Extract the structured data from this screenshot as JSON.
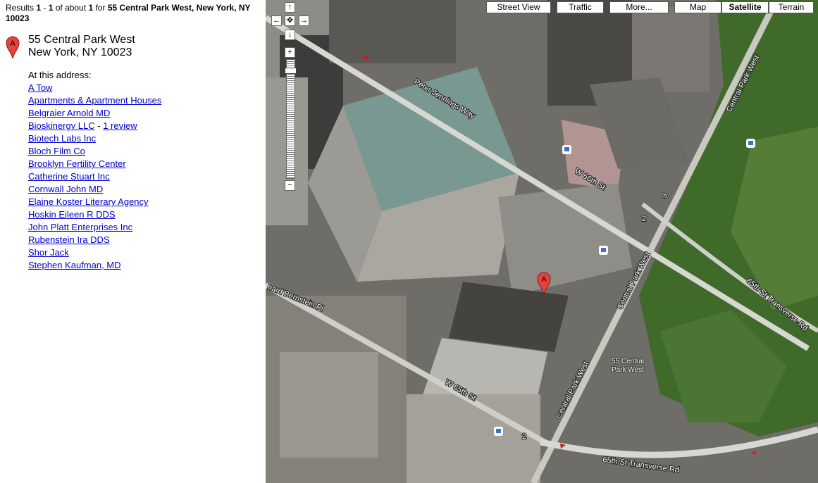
{
  "results": {
    "prefix": "Results ",
    "from": "1",
    "dash": " - ",
    "to": "1",
    "of_text": " of about ",
    "total": "1",
    "for_text": " for ",
    "query": "55 Central Park West, New York, NY 10023"
  },
  "marker_letter": "A",
  "address": {
    "line1": "55 Central Park West",
    "line2": "New York, NY 10023"
  },
  "at_address_label": "At this address:",
  "businesses": [
    {
      "name": "A Tow"
    },
    {
      "name": "Apartments & Apartment Houses"
    },
    {
      "name": "Belgraier Arnold MD"
    },
    {
      "name": "Bioskinergy LLC",
      "sep": " - ",
      "review": "1 review"
    },
    {
      "name": "Biotech Labs Inc"
    },
    {
      "name": "Bloch Film Co"
    },
    {
      "name": "Brooklyn Fertility Center"
    },
    {
      "name": "Catherine Stuart Inc"
    },
    {
      "name": "Cornwall John MD"
    },
    {
      "name": "Elaine Koster Literary Agency"
    },
    {
      "name": "Hoskin Eileen R DDS"
    },
    {
      "name": "John Platt Enterprises Inc"
    },
    {
      "name": "Rubenstein Ira DDS"
    },
    {
      "name": "Shor Jack"
    },
    {
      "name": "Stephen Kaufman, MD"
    }
  ],
  "map_buttons": {
    "street_view": "Street View",
    "traffic": "Traffic",
    "more": "More...",
    "map": "Map",
    "satellite": "Satellite",
    "terrain": "Terrain"
  },
  "nav": {
    "up": "↑",
    "left": "←",
    "center": "✥",
    "right": "→",
    "down": "↓",
    "zoom_in": "+",
    "zoom_out": "−"
  },
  "streets": {
    "peter_jennings": "Peter Jennings Way",
    "w66": "W 66th St",
    "cpw1": "Central Park West",
    "cpw2": "Central Park West",
    "cpw3": "Central Park West",
    "transverse65a": "65th St Transverse Rd",
    "transverse65b": "65th St Transverse Rd",
    "bernstein": "nard Bernstein Pl",
    "w65": "W 65th St",
    "route_a": "2",
    "route_b": "2",
    "route_c": "9"
  },
  "address_label": {
    "line1": "55 Central",
    "line2": "Park West"
  },
  "colors": {
    "link": "#0000cc",
    "marker": "#e8433b",
    "park": "#3f6a2a",
    "road": "#d8d8d2"
  }
}
